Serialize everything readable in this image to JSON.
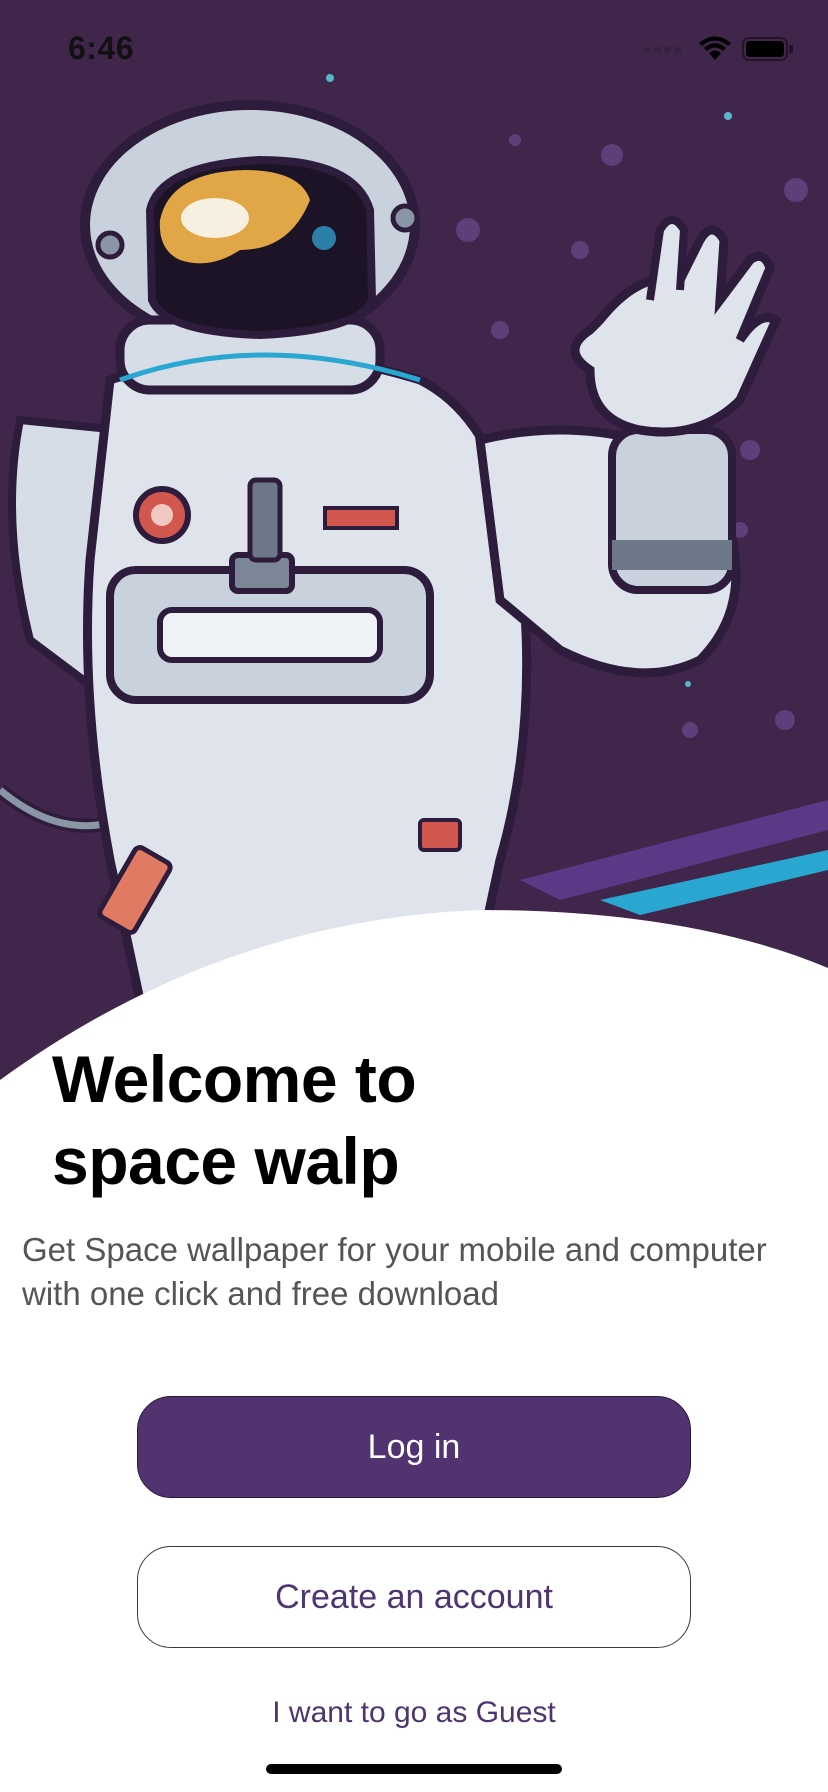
{
  "status_bar": {
    "time": "6:46",
    "icons": [
      "signal-icon",
      "wifi-icon",
      "battery-icon"
    ]
  },
  "hero": {
    "illustration": "astronaut-waving-illustration",
    "background_color": "#40264a"
  },
  "welcome": {
    "title_line1": "Welcome to",
    "title_line2": "space walp",
    "subtitle": "Get Space wallpaper for your mobile and computer with one click and free download"
  },
  "actions": {
    "login_label": "Log in",
    "create_account_label": "Create an account",
    "guest_label": "I want to go as Guest"
  },
  "colors": {
    "primary": "#50336f",
    "text_dark": "#000000",
    "text_muted": "#555555"
  }
}
